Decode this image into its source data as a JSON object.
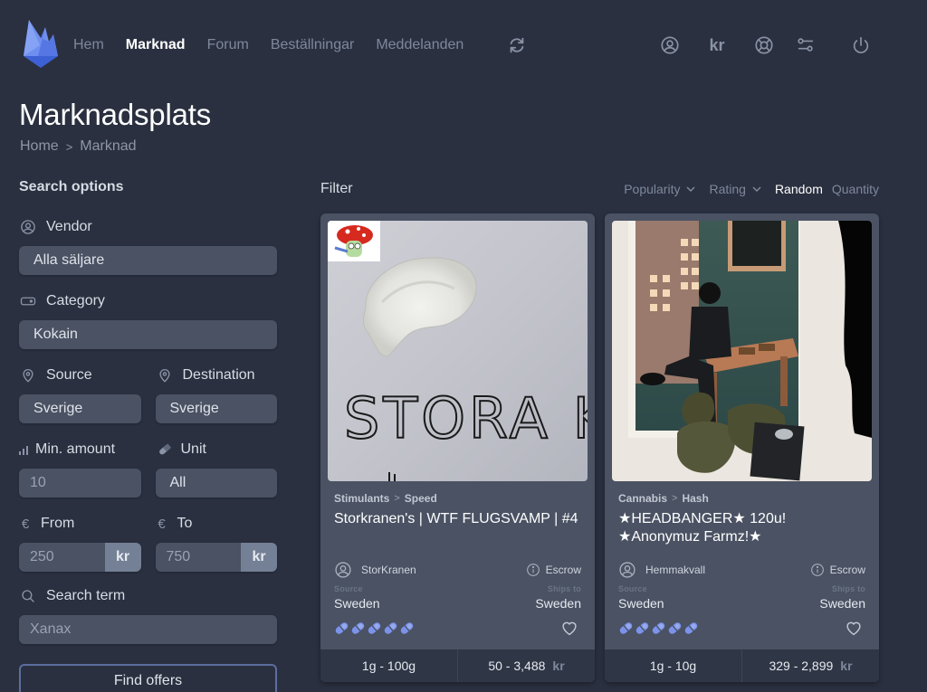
{
  "nav": {
    "links": [
      "Hem",
      "Marknad",
      "Forum",
      "Beställningar",
      "Meddelanden"
    ],
    "active_index": 1,
    "currency_label": "kr",
    "icons": [
      "refresh-icon",
      "user-icon",
      "currency-kr-icon",
      "support-lifebuoy-icon",
      "settings-sliders-icon",
      "power-icon"
    ]
  },
  "page": {
    "title": "Marknadsplats",
    "breadcrumb": [
      "Home",
      "Marknad"
    ],
    "breadcrumb_separator": ">"
  },
  "sidebar": {
    "heading": "Search options",
    "vendor": {
      "label": "Vendor",
      "value": "Alla säljare"
    },
    "category": {
      "label": "Category",
      "value": "Kokain"
    },
    "source": {
      "label": "Source",
      "value": "Sverige"
    },
    "destination": {
      "label": "Destination",
      "value": "Sverige"
    },
    "min_amount": {
      "label": "Min. amount",
      "value": "10"
    },
    "unit": {
      "label": "Unit",
      "value": "All"
    },
    "price_from": {
      "label": "From",
      "value": "250",
      "addon": "kr",
      "icon": "€"
    },
    "price_to": {
      "label": "To",
      "value": "750",
      "addon": "kr",
      "icon": "€"
    },
    "search_term": {
      "label": "Search term",
      "value": "Xanax"
    },
    "submit_label": "Find offers"
  },
  "filter": {
    "label": "Filter",
    "sort_options": [
      {
        "label": "Popularity",
        "dropdown": true,
        "active": false
      },
      {
        "label": "Rating",
        "dropdown": true,
        "active": false
      },
      {
        "label": "Random",
        "dropdown": false,
        "active": true
      },
      {
        "label": "Quantity",
        "dropdown": false,
        "active": false
      }
    ]
  },
  "listings": [
    {
      "category": "Stimulants",
      "subcategory": "Speed",
      "title": "Storkranen's | WTF FLUGSVAMP | #4",
      "vendor": "StorKranen",
      "escrow_label": "Escrow",
      "source_label": "Source",
      "source": "Sweden",
      "ships_to_label": "Ships to",
      "ships_to": "Sweden",
      "rating": 5,
      "rating_max": 5,
      "quantity_range": "1g - 100g",
      "price_range": "50 - 3,488",
      "currency": "kr",
      "image_desc": "white powder on paper with handwritten 'STORA K', mushroom mascot badge",
      "image_text": "STORA K"
    },
    {
      "category": "Cannabis",
      "subcategory": "Hash",
      "title": "★HEADBANGER★ 120u! ★Anonymuz Farmz!★",
      "vendor": "Hemmakvall",
      "escrow_label": "Escrow",
      "source_label": "Source",
      "source": "Sweden",
      "ships_to_label": "Ships to",
      "ships_to": "Sweden",
      "rating": 5,
      "rating_max": 5,
      "quantity_range": "1g - 10g",
      "price_range": "329 - 2,899",
      "currency": "kr",
      "image_desc": "hash chunks in front of illustrated poster of masked man at table"
    }
  ],
  "colors": {
    "background": "#2a3040",
    "card": "#4a5263",
    "input": "#4a5263",
    "accent": "#5b7be0",
    "rating_pill": "#7b93ea",
    "button_border": "#5c6e9e"
  }
}
